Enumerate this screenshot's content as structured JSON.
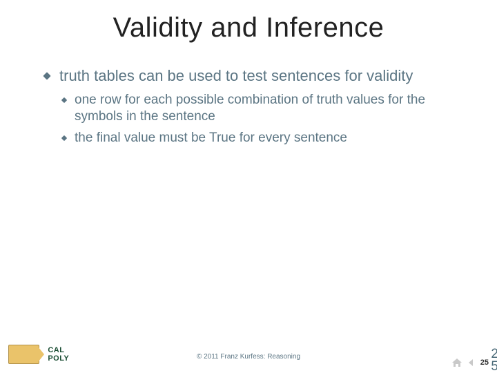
{
  "title": "Validity and Inference",
  "bullets": {
    "main": "truth tables can be used to test sentences for validity",
    "sub1": "one row for each possible combination of truth values for the symbols in the sentence",
    "sub2": "the final value must be True for every sentence"
  },
  "footer": {
    "copyright": "© 2011  Franz Kurfess: Reasoning",
    "logo_text": "CAL POLY",
    "page_number": "25",
    "side_a": "2",
    "side_b": "5"
  }
}
